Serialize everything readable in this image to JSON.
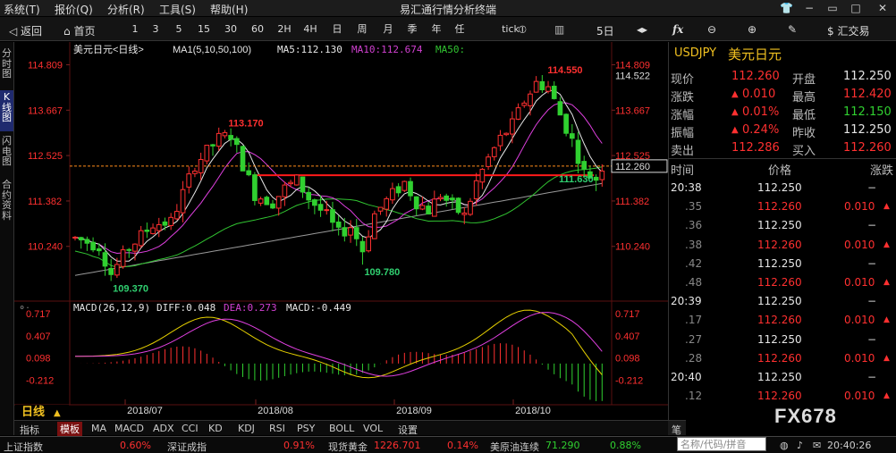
{
  "app_title": "易汇通行情分析终端",
  "menu": [
    "系统(T)",
    "报价(Q)",
    "分析(R)",
    "工具(S)",
    "帮助(H)"
  ],
  "toolbar": {
    "back": "返回",
    "home": "首页",
    "periods": [
      "1",
      "3",
      "5",
      "15",
      "30",
      "60",
      "2H",
      "4H",
      "日",
      "周",
      "月",
      "季",
      "年",
      "任",
      "tick"
    ],
    "five_day": "5日",
    "trade": "汇交易"
  },
  "left_tabs": [
    "分时图",
    "K线图",
    "闪电图",
    "合约资料"
  ],
  "chart_header": {
    "symbol": "美元日元<日线>",
    "ma_settings": "MA1(5,10,50,100)",
    "ma5": "MA5:112.130",
    "ma10": "MA10:112.674",
    "ma50": "MA50:"
  },
  "macd_header": {
    "settings": "MACD(26,12,9)",
    "diff": "DIFF:0.048",
    "dea": "DEA:0.273",
    "macd": "MACD:-0.449"
  },
  "period_indicator": "日线",
  "chart_data": {
    "type": "candlestick",
    "title": "美元日元<日线>",
    "price_ticks": [
      "114.809",
      "113.667",
      "112.525",
      "111.382",
      "110.240"
    ],
    "price_range": [
      109.2,
      115.0
    ],
    "current_price_label": "112.260",
    "reference_line_label": "114.522",
    "date_ticks": [
      "2018/07",
      "2018/08",
      "2018/09",
      "2018/10"
    ],
    "annotations": [
      {
        "text": "113.170",
        "color": "#ff3030"
      },
      {
        "text": "114.550",
        "color": "#ff3030"
      },
      {
        "text": "109.370",
        "color": "#30d070"
      },
      {
        "text": "109.780",
        "color": "#30d070"
      },
      {
        "text": "111.630",
        "color": "#30d070"
      }
    ],
    "support_line_level": 112.03,
    "macd_ticks": [
      "0.717",
      "0.407",
      "0.098",
      "-0.212"
    ],
    "macd_range": [
      -0.52,
      0.82
    ],
    "colors": {
      "up": "#ff3030",
      "down": "#30d030",
      "ma5": "#e6e6e6",
      "ma10": "#e040e0",
      "ma50": "#31c431",
      "ma100": "#9a9a9a",
      "support": "#ff1a1a",
      "current": "#ff8c1a"
    }
  },
  "quote": {
    "code": "USDJPY",
    "name": "美元日元",
    "fields": [
      {
        "l1": "现价",
        "v1": "112.260",
        "c1": "#ff3030",
        "l2": "开盘",
        "v2": "112.250",
        "c2": "#e6e6e6"
      },
      {
        "l1": "涨跌",
        "v1": "0.010",
        "c1": "#ff3030",
        "a1": "up",
        "l2": "最高",
        "v2": "112.420",
        "c2": "#ff3030"
      },
      {
        "l1": "涨幅",
        "v1": "0.01%",
        "c1": "#ff3030",
        "a1": "up",
        "l2": "最低",
        "v2": "112.150",
        "c2": "#30d030"
      },
      {
        "l1": "振幅",
        "v1": "0.24%",
        "c1": "#ff3030",
        "a1": "up",
        "l2": "昨收",
        "v2": "112.250",
        "c2": "#e6e6e6"
      },
      {
        "l1": "卖出",
        "v1": "112.286",
        "c1": "#ff3030",
        "l2": "买入",
        "v2": "112.260",
        "c2": "#ff3030"
      }
    ]
  },
  "ticks_header": [
    "时间",
    "价格",
    "涨跌"
  ],
  "ticks": [
    {
      "time": "20:38",
      "price": "112.250",
      "change": "−",
      "up": false
    },
    {
      "time": ".35",
      "price": "112.260",
      "change": "0.010",
      "up": true
    },
    {
      "time": ".36",
      "price": "112.250",
      "change": "−",
      "up": false
    },
    {
      "time": ".38",
      "price": "112.260",
      "change": "0.010",
      "up": true
    },
    {
      "time": ".42",
      "price": "112.250",
      "change": "−",
      "up": false
    },
    {
      "time": ".48",
      "price": "112.260",
      "change": "0.010",
      "up": true
    },
    {
      "time": "20:39",
      "price": "112.250",
      "change": "−",
      "up": false
    },
    {
      "time": ".17",
      "price": "112.260",
      "change": "0.010",
      "up": true
    },
    {
      "time": ".27",
      "price": "112.250",
      "change": "−",
      "up": false
    },
    {
      "time": ".28",
      "price": "112.260",
      "change": "0.010",
      "up": true
    },
    {
      "time": "20:40",
      "price": "112.250",
      "change": "−",
      "up": false
    },
    {
      "time": ".12",
      "price": "112.260",
      "change": "0.010",
      "up": true
    }
  ],
  "indicator_tabs": [
    "指标",
    "模板",
    "MA",
    "MACD",
    "ADX",
    "CCI",
    "KD",
    "KDJ",
    "RSI",
    "PSY",
    "BOLL",
    "VOL",
    "设置"
  ],
  "active_indicator_tab": "模板",
  "pen_tab": "笔",
  "watermark": "FX678",
  "status": [
    {
      "name": "上证指数",
      "value": "0.60%"
    },
    {
      "name": "深证成指",
      "value": "0.91%"
    },
    {
      "name": "现货黄金",
      "value": "1226.701",
      "change": "0.14%"
    },
    {
      "name": "美原油连续",
      "value": "71.290",
      "change": "0.88%"
    }
  ],
  "search": {
    "placeholder": "名称/代码/拼音"
  },
  "clock": "20:40:26"
}
